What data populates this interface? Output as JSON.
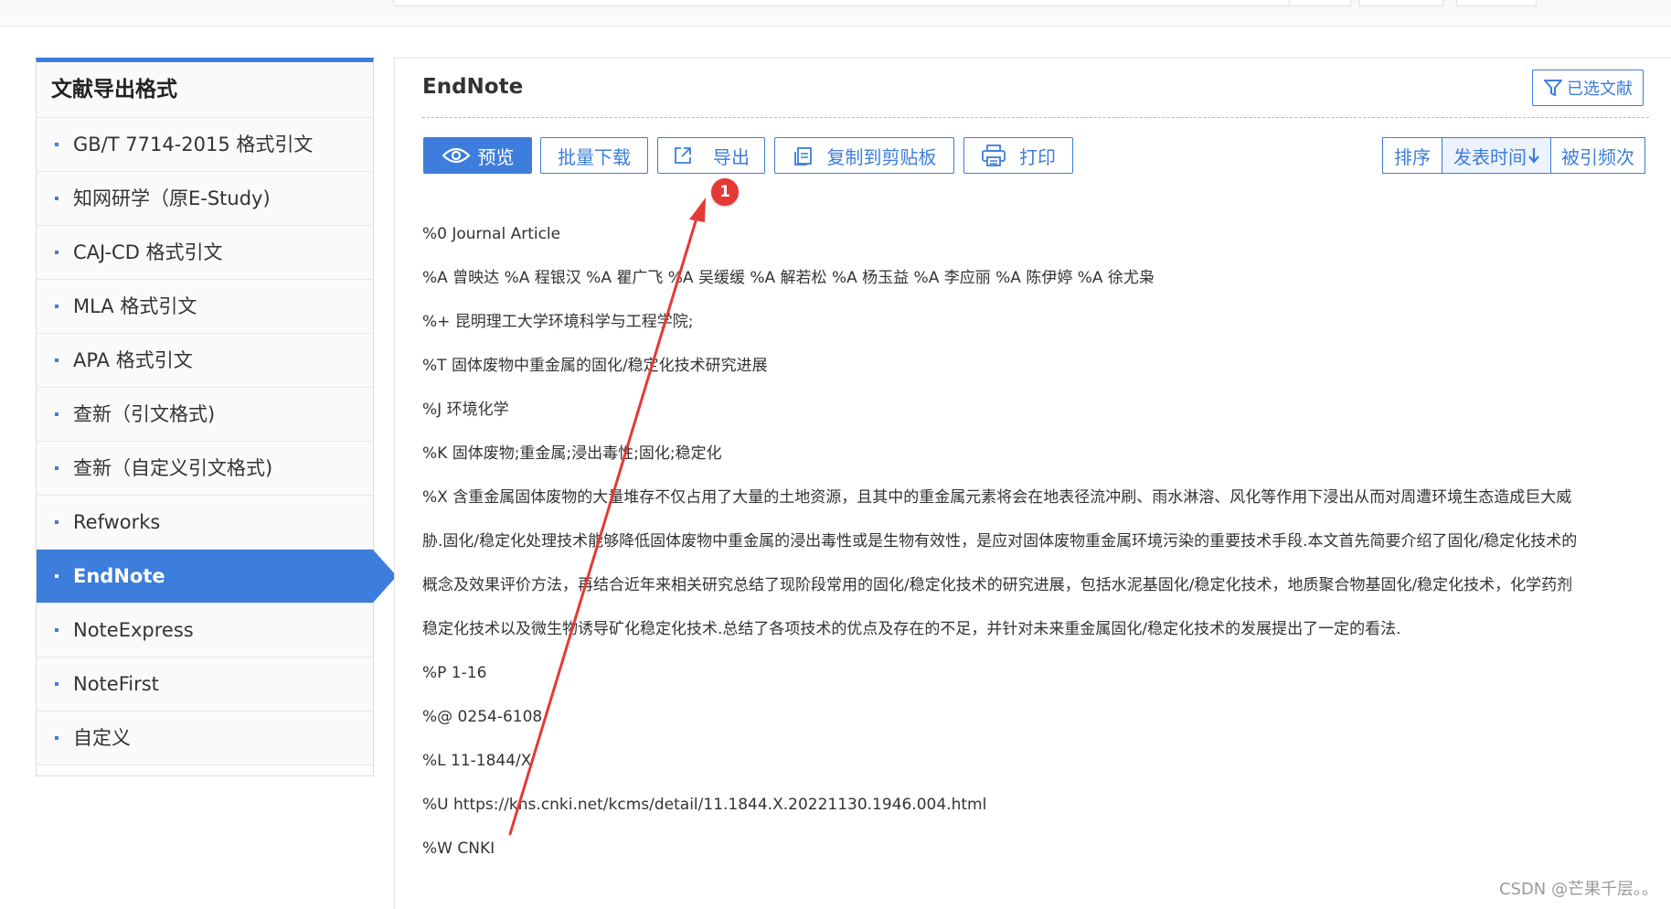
{
  "sidebar": {
    "title": "文献导出格式",
    "items": [
      {
        "label": "GB/T 7714-2015 格式引文"
      },
      {
        "label": "知网研学（原E-Study)"
      },
      {
        "label": "CAJ-CD 格式引文"
      },
      {
        "label": "MLA 格式引文"
      },
      {
        "label": "APA 格式引文"
      },
      {
        "label": "查新（引文格式)"
      },
      {
        "label": "查新（自定义引文格式)"
      },
      {
        "label": "Refworks"
      },
      {
        "label": "EndNote"
      },
      {
        "label": "NoteExpress"
      },
      {
        "label": "NoteFirst"
      },
      {
        "label": "自定义"
      }
    ],
    "active_index": 8
  },
  "main": {
    "title": "EndNote",
    "selected_button": "已选文献",
    "toolbar": {
      "preview": "预览",
      "batch_download": "批量下载",
      "export": "导出",
      "copy_clipboard": "复制到剪贴板",
      "print": "打印"
    },
    "sort": {
      "label": "排序",
      "time": "发表时间",
      "cited": "被引频次"
    },
    "record": {
      "type": "%0 Journal Article",
      "authors": "%A 曾映达 %A 程银汉 %A 瞿广飞 %A 吴缓缓 %A 解若松 %A 杨玉益 %A 李应丽 %A 陈伊婷 %A 徐尤枭",
      "affiliation": "%+ 昆明理工大学环境科学与工程学院;",
      "title": "%T 固体废物中重金属的固化/稳定化技术研究进展",
      "journal": "%J 环境化学",
      "keywords": "%K 固体废物;重金属;浸出毒性;固化;稳定化",
      "abstract_lines": [
        "%X 含重金属固体废物的大量堆存不仅占用了大量的土地资源，且其中的重金属元素将会在地表径流冲刷、雨水淋溶、风化等作用下浸出从而对周遭环境生态造成巨大威",
        "胁.固化/稳定化处理技术能够降低固体废物中重金属的浸出毒性或是生物有效性，是应对固体废物重金属环境污染的重要技术手段.本文首先简要介绍了固化/稳定化技术的",
        "概念及效果评价方法，再结合近年来相关研究总结了现阶段常用的固化/稳定化技术的研究进展，包括水泥基固化/稳定化技术，地质聚合物基固化/稳定化技术，化学药剂",
        "稳定化技术以及微生物诱导矿化稳定化技术.总结了各项技术的优点及存在的不足，并针对未来重金属固化/稳定化技术的发展提出了一定的看法."
      ],
      "pages": "%P 1-16",
      "issn": "%@ 0254-6108",
      "cn": "%L 11-1844/X",
      "url": "%U https://kns.cnki.net/kcms/detail/11.1844.X.20221130.1946.004.html",
      "database": "%W CNKI"
    }
  },
  "annotation": {
    "badge": "1",
    "color": "#e53935"
  },
  "watermark": "CSDN @芒果千层。。",
  "colors": {
    "accent": "#3d7ddb"
  }
}
